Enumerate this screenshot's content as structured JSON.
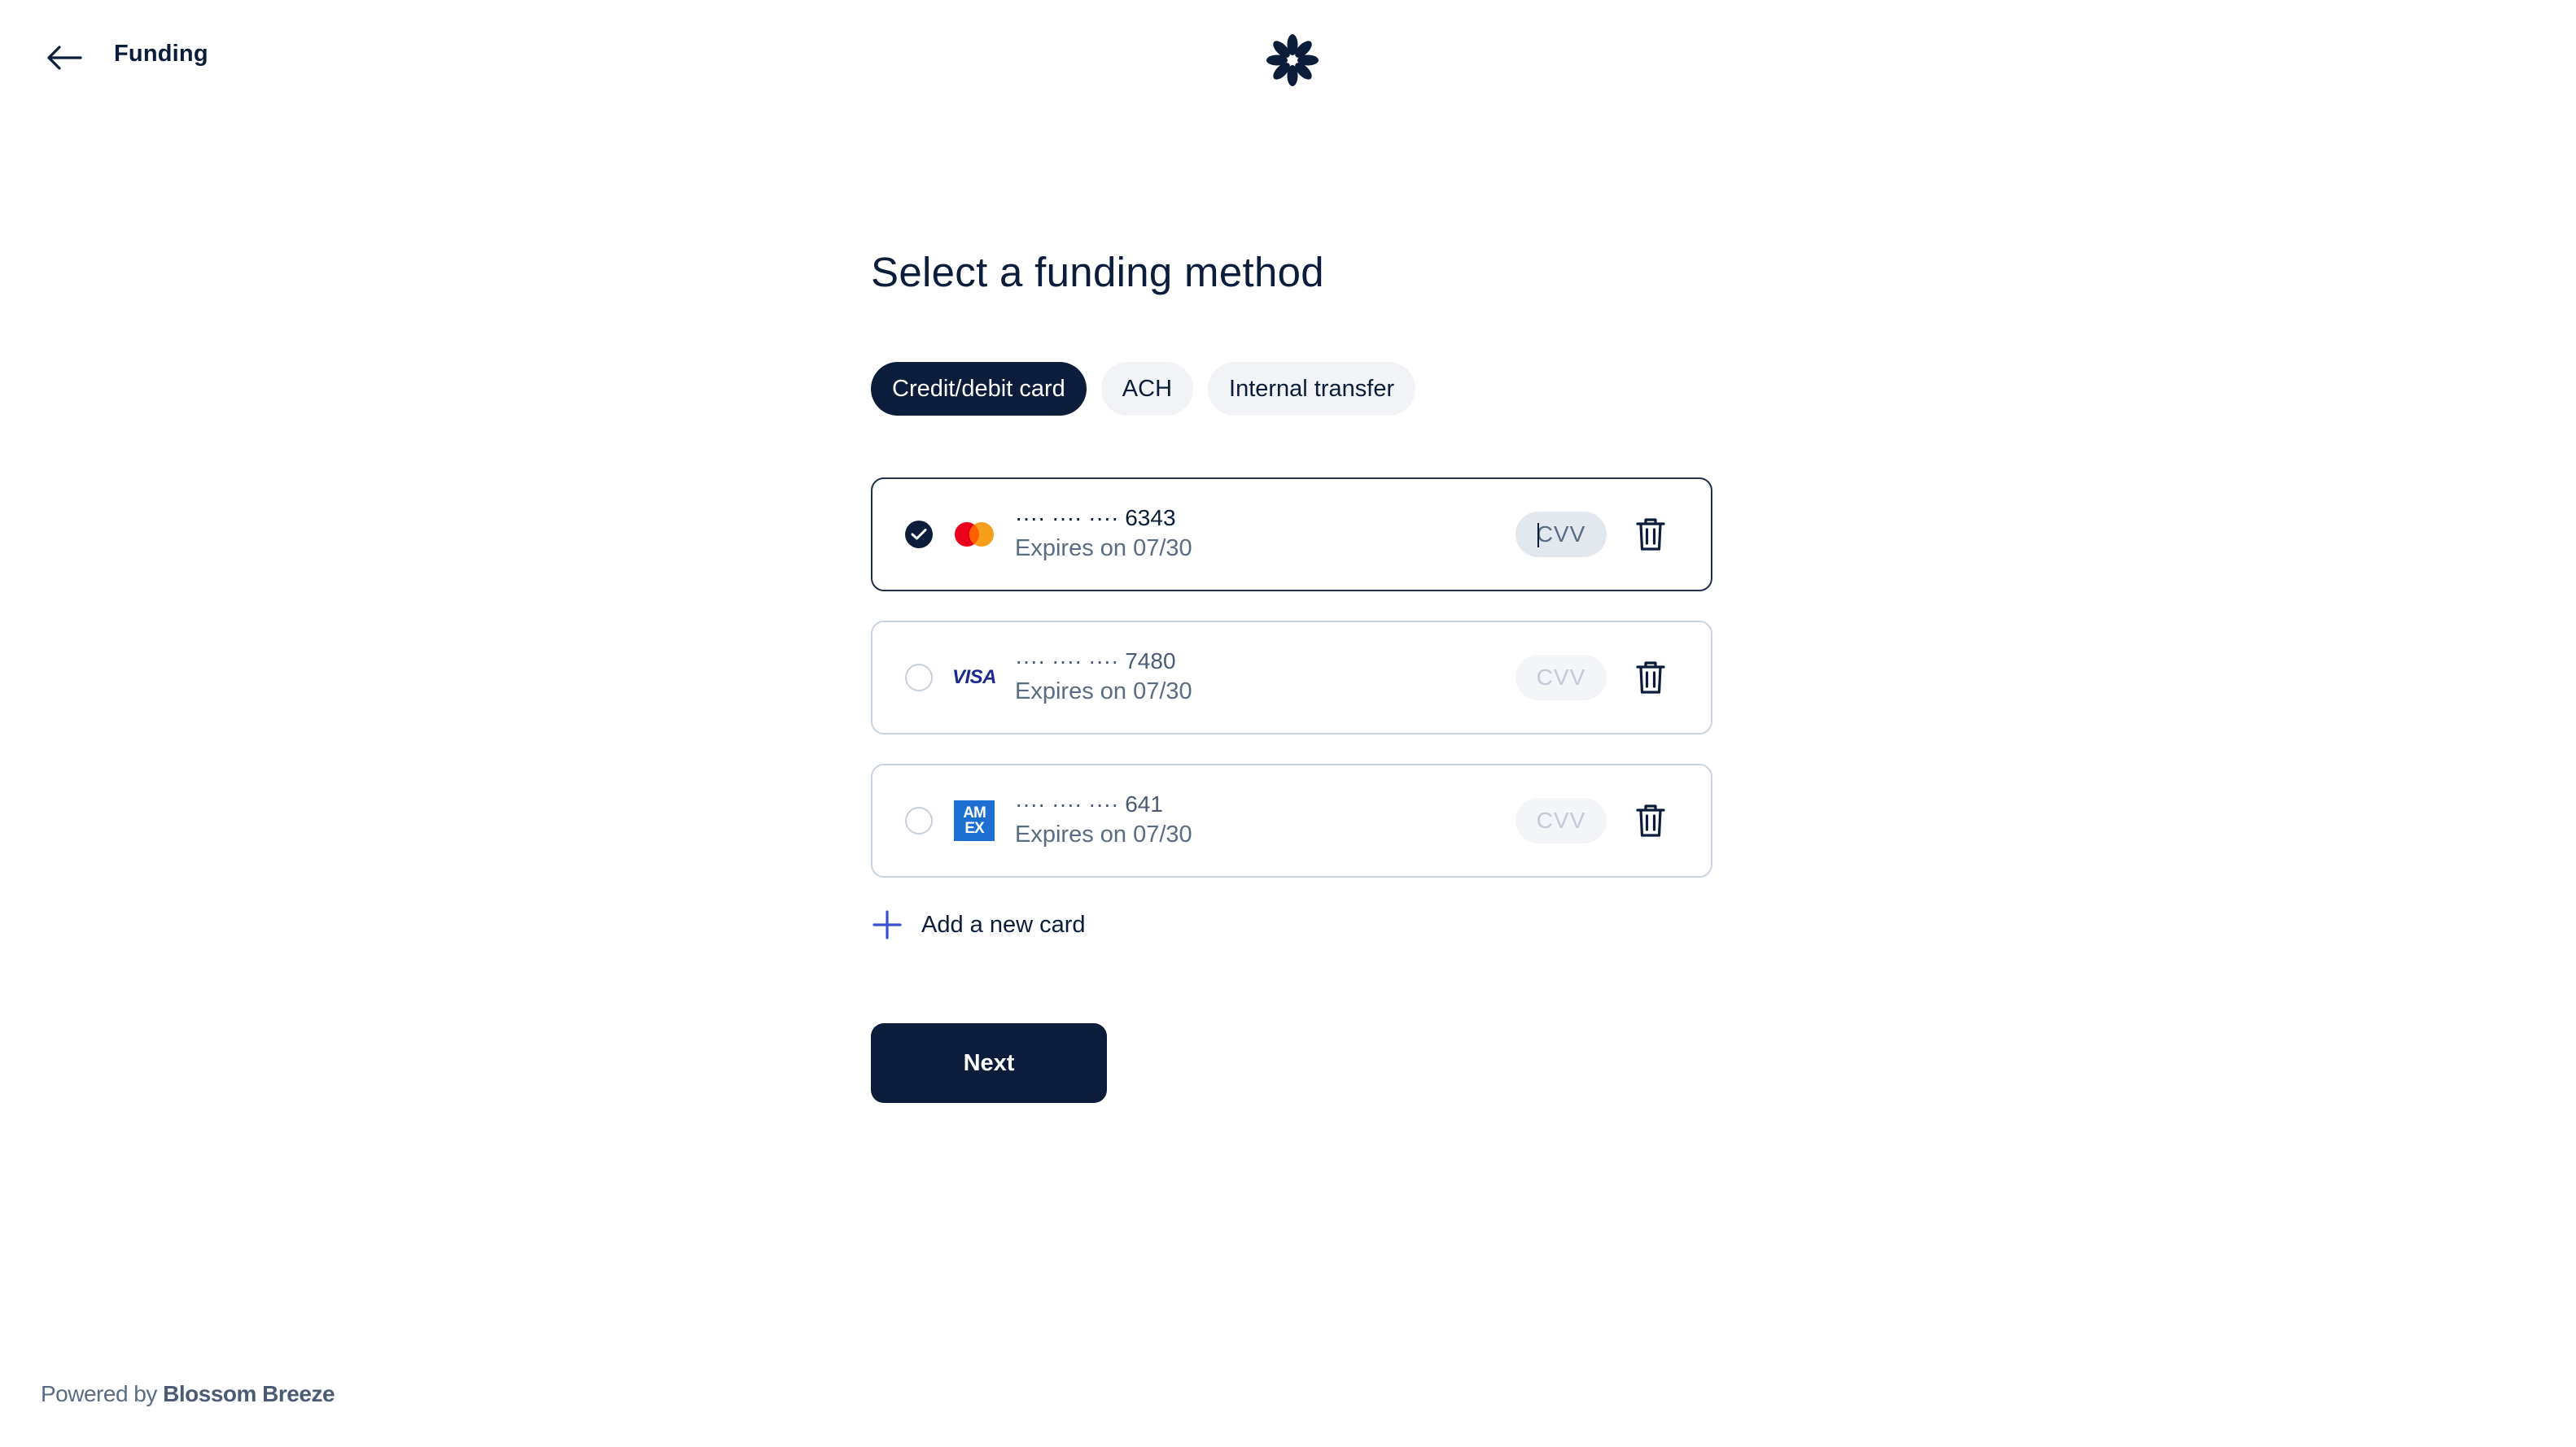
{
  "header": {
    "title": "Funding",
    "back_icon": "arrow-left-icon",
    "logo_icon": "flower-logo-icon"
  },
  "main": {
    "title": "Select a funding method",
    "tabs": [
      {
        "label": "Credit/debit card",
        "active": true
      },
      {
        "label": "ACH",
        "active": false
      },
      {
        "label": "Internal transfer",
        "active": false
      }
    ],
    "cards": [
      {
        "brand": "mastercard",
        "number": "···· ···· ···· 6343",
        "expiry": "Expires on 07/30",
        "selected": true,
        "cvv_placeholder": "CVV"
      },
      {
        "brand": "visa",
        "brand_label": "VISA",
        "number": "···· ···· ···· 7480",
        "expiry": "Expires on 07/30",
        "selected": false,
        "cvv_placeholder": "CVV"
      },
      {
        "brand": "amex",
        "brand_label_top": "AM",
        "brand_label_bottom": "EX",
        "number": "···· ···· ···· 641",
        "expiry": "Expires on 07/30",
        "selected": false,
        "cvv_placeholder": "CVV"
      }
    ],
    "add_card_label": "Add a new card",
    "next_label": "Next"
  },
  "footer": {
    "prefix": "Powered by",
    "brand": "Blossom Breeze"
  },
  "colors": {
    "primary": "#0b1d3a",
    "accent": "#3b4fd6",
    "mastercard_red": "#eb001b",
    "mastercard_orange": "#f79e1b",
    "visa_blue": "#1a2a8f",
    "amex_blue": "#1d6fd1"
  }
}
